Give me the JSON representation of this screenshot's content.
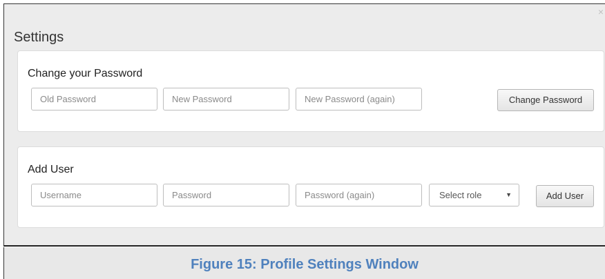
{
  "window": {
    "title": "Settings",
    "close_glyph": "×"
  },
  "change_password": {
    "heading": "Change your Password",
    "old_password_placeholder": "Old Password",
    "new_password_placeholder": "New Password",
    "new_password_again_placeholder": "New Password (again)",
    "button_label": "Change Password"
  },
  "add_user": {
    "heading": "Add User",
    "username_placeholder": "Username",
    "password_placeholder": "Password",
    "password_again_placeholder": "Password (again)",
    "role_select_value": "Select role",
    "button_label": "Add User"
  },
  "caption": "Figure 15: Profile Settings Window",
  "colors": {
    "caption_text": "#4f81bd",
    "window_bg": "#ececec",
    "panel_bg": "#ffffff"
  }
}
